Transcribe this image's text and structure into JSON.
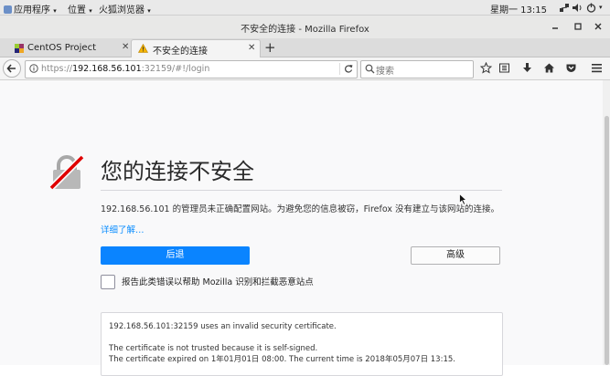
{
  "topbar": {
    "applications": "应用程序",
    "places": "位置",
    "app_name": "火狐浏览器",
    "clock": "星期一 13:15"
  },
  "window": {
    "title": "不安全的连接 - Mozilla Firefox"
  },
  "tabs": [
    {
      "label": "CentOS Project"
    },
    {
      "label": "不安全的连接"
    }
  ],
  "navbar": {
    "url_prefix": "https://",
    "url_host": "192.168.56.101",
    "url_rest": ":32159/#!/login",
    "search_placeholder": "搜索"
  },
  "error_page": {
    "heading": "您的连接不安全",
    "description": "192.168.56.101 的管理员未正确配置网站。为避免您的信息被窃，Firefox 没有建立与该网站的连接。",
    "details_link": "详细了解…",
    "back_button": "后退",
    "advanced_button": "高级",
    "report_checkbox_label": "报告此类错误以帮助 Mozilla 识别和拦截恶意站点",
    "cert_details": [
      "192.168.56.101:32159 uses an invalid security certificate.",
      "",
      "The certificate is not trusted because it is self-signed.",
      "The certificate expired on 1年01月01日 08:00. The current time is 2018年05月07日 13:15."
    ]
  },
  "colors": {
    "primary_button": "#0a84ff",
    "warning_icon": "#e00000",
    "link": "#0a8dff"
  }
}
